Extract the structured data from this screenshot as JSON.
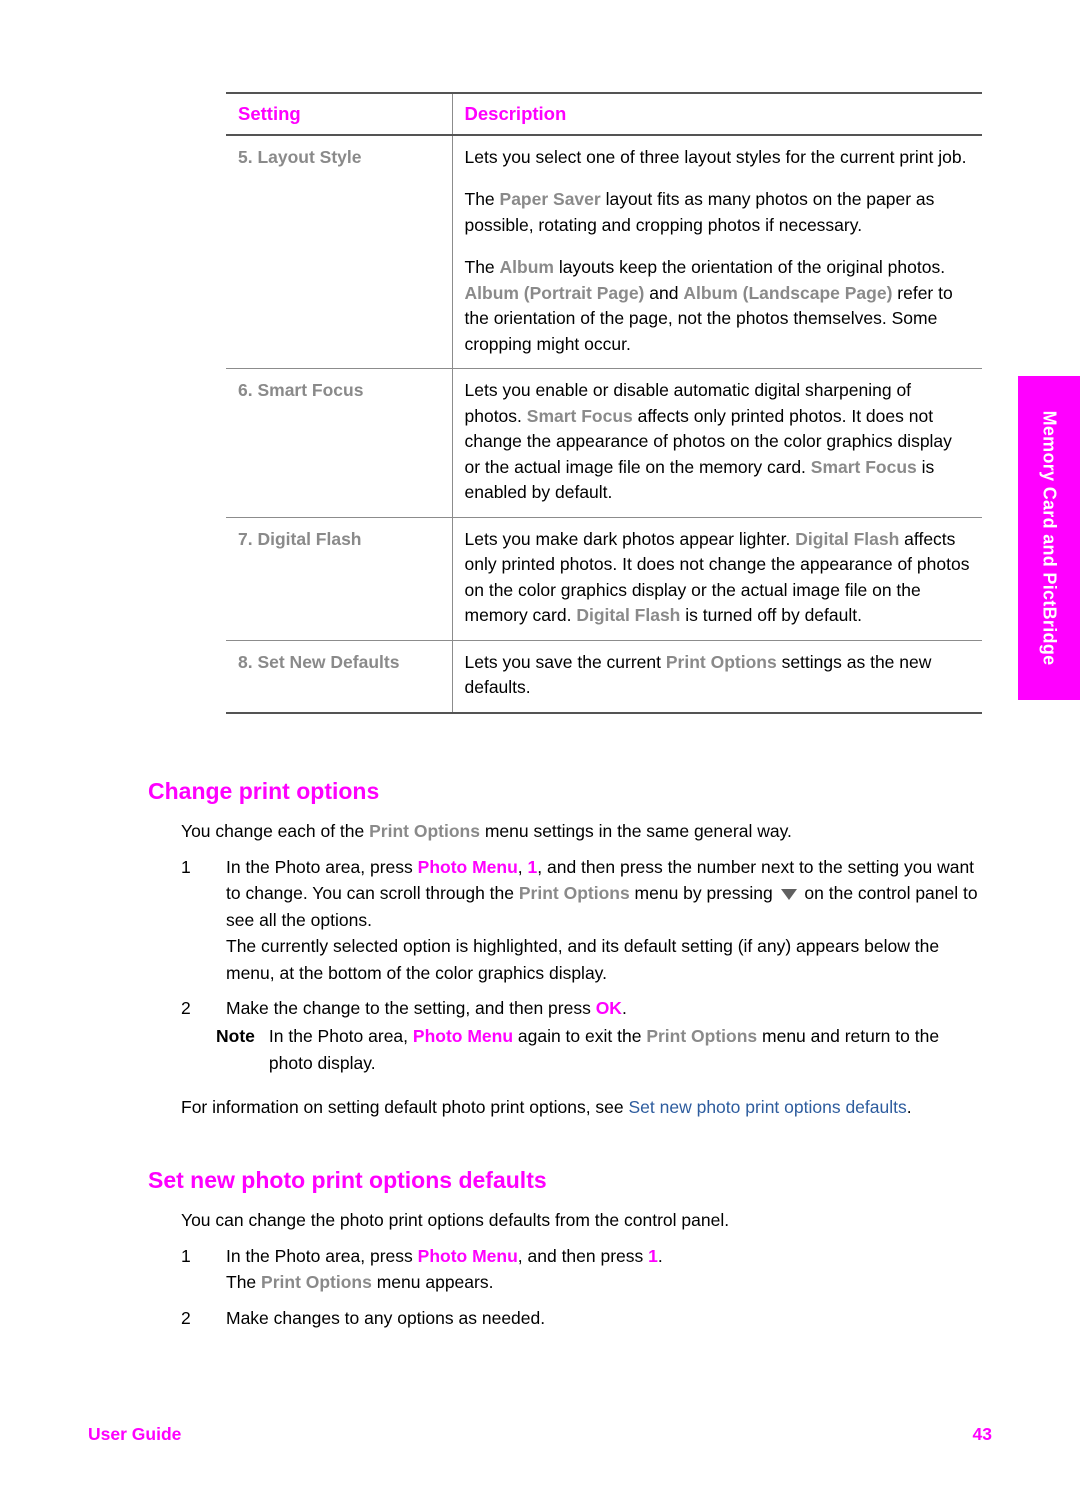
{
  "table": {
    "headers": [
      "Setting",
      "Description"
    ],
    "rows": [
      {
        "setting": "5. Layout Style",
        "paragraphs": [
          {
            "segments": [
              {
                "t": "Lets you select one of three layout styles for the current print job.",
                "s": "plain"
              }
            ]
          },
          {
            "segments": [
              {
                "t": "The ",
                "s": "plain"
              },
              {
                "t": "Paper Saver",
                "s": "ui"
              },
              {
                "t": " layout fits as many photos on the paper as possible, rotating and cropping photos if necessary.",
                "s": "plain"
              }
            ]
          },
          {
            "segments": [
              {
                "t": "The ",
                "s": "plain"
              },
              {
                "t": "Album",
                "s": "ui"
              },
              {
                "t": " layouts keep the orientation of the original photos. ",
                "s": "plain"
              },
              {
                "t": "Album (Portrait Page)",
                "s": "ui"
              },
              {
                "t": " and ",
                "s": "plain"
              },
              {
                "t": "Album (Landscape Page)",
                "s": "ui"
              },
              {
                "t": " refer to the orientation of the page, not the photos themselves. Some cropping might occur.",
                "s": "plain"
              }
            ]
          }
        ]
      },
      {
        "setting": "6. Smart Focus",
        "paragraphs": [
          {
            "segments": [
              {
                "t": "Lets you enable or disable automatic digital sharpening of photos. ",
                "s": "plain"
              },
              {
                "t": "Smart Focus",
                "s": "ui"
              },
              {
                "t": " affects only printed photos. It does not change the appearance of photos on the color graphics display or the actual image file on the memory card. ",
                "s": "plain"
              },
              {
                "t": "Smart Focus",
                "s": "ui"
              },
              {
                "t": " is enabled by default.",
                "s": "plain"
              }
            ]
          }
        ]
      },
      {
        "setting": "7. Digital Flash",
        "paragraphs": [
          {
            "segments": [
              {
                "t": "Lets you make dark photos appear lighter. ",
                "s": "plain"
              },
              {
                "t": "Digital Flash",
                "s": "ui"
              },
              {
                "t": " affects only printed photos. It does not change the appearance of photos on the color graphics display or the actual image file on the memory card. ",
                "s": "plain"
              },
              {
                "t": "Digital Flash",
                "s": "ui"
              },
              {
                "t": " is turned off by default.",
                "s": "plain"
              }
            ]
          }
        ]
      },
      {
        "setting": "8. Set New Defaults",
        "paragraphs": [
          {
            "segments": [
              {
                "t": "Lets you save the current ",
                "s": "plain"
              },
              {
                "t": "Print Options",
                "s": "ui"
              },
              {
                "t": " settings as the new defaults.",
                "s": "plain"
              }
            ]
          }
        ]
      }
    ]
  },
  "side_tab": {
    "label": "Memory Card and PictBridge",
    "background": "#ff00ff",
    "text_color": "#ffffff"
  },
  "sections": [
    {
      "id": "change-print-options",
      "heading": "Change print options",
      "lead": {
        "segments": [
          {
            "t": "You change each of the ",
            "s": "plain"
          },
          {
            "t": "Print Options",
            "s": "ui"
          },
          {
            "t": " menu settings in the same general way.",
            "s": "plain"
          }
        ]
      },
      "steps": [
        {
          "num": "1",
          "segments": [
            {
              "t": "In the Photo area, press ",
              "s": "plain"
            },
            {
              "t": "Photo Menu",
              "s": "mag"
            },
            {
              "t": ", ",
              "s": "plain"
            },
            {
              "t": "1",
              "s": "mag"
            },
            {
              "t": ", and then press the number next to the setting you want to change. You can scroll through the ",
              "s": "plain"
            },
            {
              "t": "Print Options",
              "s": "ui"
            },
            {
              "t": " menu by pressing ",
              "s": "plain"
            },
            {
              "t": "",
              "s": "tri-down"
            },
            {
              "t": " on the control panel to see all the options.",
              "s": "plain"
            }
          ],
          "sub": {
            "segments": [
              {
                "t": "The currently selected option is highlighted, and its default setting (if any) appears below the menu, at the bottom of the color graphics display.",
                "s": "plain"
              }
            ]
          }
        },
        {
          "num": "2",
          "segments": [
            {
              "t": "Make the change to the setting, and then press ",
              "s": "plain"
            },
            {
              "t": "OK",
              "s": "mag"
            },
            {
              "t": ".",
              "s": "plain"
            }
          ]
        }
      ]
    },
    {
      "id": "set-new-photo-print-options-defaults",
      "heading": "Set new photo print options defaults",
      "lead": {
        "segments": [
          {
            "t": "You can change the photo print options defaults from the control panel.",
            "s": "plain"
          }
        ]
      },
      "steps": [
        {
          "num": "1",
          "segments": [
            {
              "t": "In the Photo area, press ",
              "s": "plain"
            },
            {
              "t": "Photo Menu",
              "s": "mag"
            },
            {
              "t": ", and then press ",
              "s": "plain"
            },
            {
              "t": "1",
              "s": "mag"
            },
            {
              "t": ".",
              "s": "plain"
            }
          ],
          "sub": {
            "segments": [
              {
                "t": "The ",
                "s": "plain"
              },
              {
                "t": "Print Options",
                "s": "ui"
              },
              {
                "t": " menu appears.",
                "s": "plain"
              }
            ]
          }
        },
        {
          "num": "2",
          "segments": [
            {
              "t": "Make changes to any options as needed.",
              "s": "plain"
            }
          ]
        }
      ]
    }
  ],
  "note": {
    "label": "Note",
    "segments": [
      {
        "t": "In the Photo area, ",
        "s": "plain"
      },
      {
        "t": "Photo Menu",
        "s": "mag"
      },
      {
        "t": " again to exit the ",
        "s": "plain"
      },
      {
        "t": "Print Options",
        "s": "ui"
      },
      {
        "t": " menu and return to the photo display.",
        "s": "plain"
      }
    ]
  },
  "xref_paragraph": {
    "segments": [
      {
        "t": "For information on setting default photo print options, see ",
        "s": "plain"
      },
      {
        "t": "Set new photo print options defaults",
        "s": "xref"
      },
      {
        "t": ".",
        "s": "plain"
      }
    ]
  },
  "footer": {
    "left": "User Guide",
    "right": "43"
  },
  "colors": {
    "accent_magenta": "#ff00ff",
    "ui_label_gray": "#8a8a8a",
    "xref_blue": "#2d5c9e",
    "rule_dark": "#545454",
    "rule_light": "#8c8c8c"
  }
}
